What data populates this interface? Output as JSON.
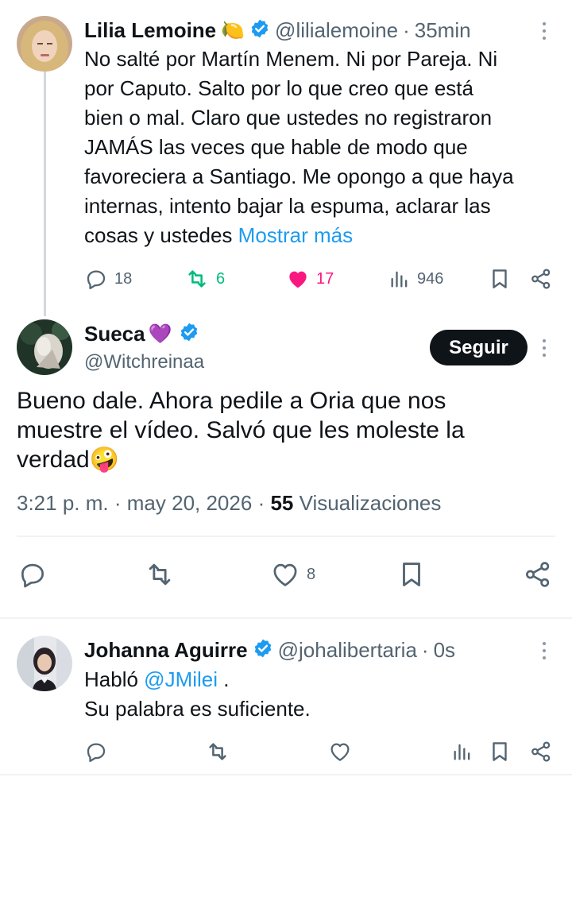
{
  "tweet1": {
    "name": "Lilia Lemoine",
    "emoji": "🍋",
    "handle": "@lilialemoine",
    "dot": "·",
    "time": "35min",
    "lines": [
      "No salté por Martín Menem. Ni por Pareja. Ni",
      "por Caputo. Salto por lo que creo que está",
      "bien o mal. Claro que ustedes no registraron",
      "JAMÁS las veces que hable de modo que",
      "favoreciera a Santiago. Me opongo a que haya",
      "internas, intento bajar la espuma, aclarar las",
      "cosas y ustedes"
    ],
    "show_more": "Mostrar más",
    "replies": "18",
    "retweets": "6",
    "likes": "17",
    "views": "946"
  },
  "tweet2": {
    "name": "Sueca",
    "emoji": "💜",
    "handle": "@Witchreinaa",
    "follow": "Seguir",
    "lines": [
      "Bueno dale. Ahora pedile a Oria que nos",
      "muestre el vídeo. Salvó que les moleste la",
      "verdad🤪"
    ],
    "time": "3:21 p. m.",
    "dot": "·",
    "date": "may 20, 2026",
    "views_count": "55",
    "views_label": "Visualizaciones",
    "likes": "8"
  },
  "tweet3": {
    "name": "Johanna Aguirre",
    "handle": "@johalibertaria",
    "dot": "·",
    "time": "0s",
    "text_pre": "Habló",
    "mention": "@JMilei",
    "text_post": ".",
    "line2": "Su palabra es suficiente."
  },
  "colors": {
    "verified": "#1d9bf0",
    "retweet": "#00ba7c",
    "like": "#f91880",
    "muted": "#536471"
  }
}
